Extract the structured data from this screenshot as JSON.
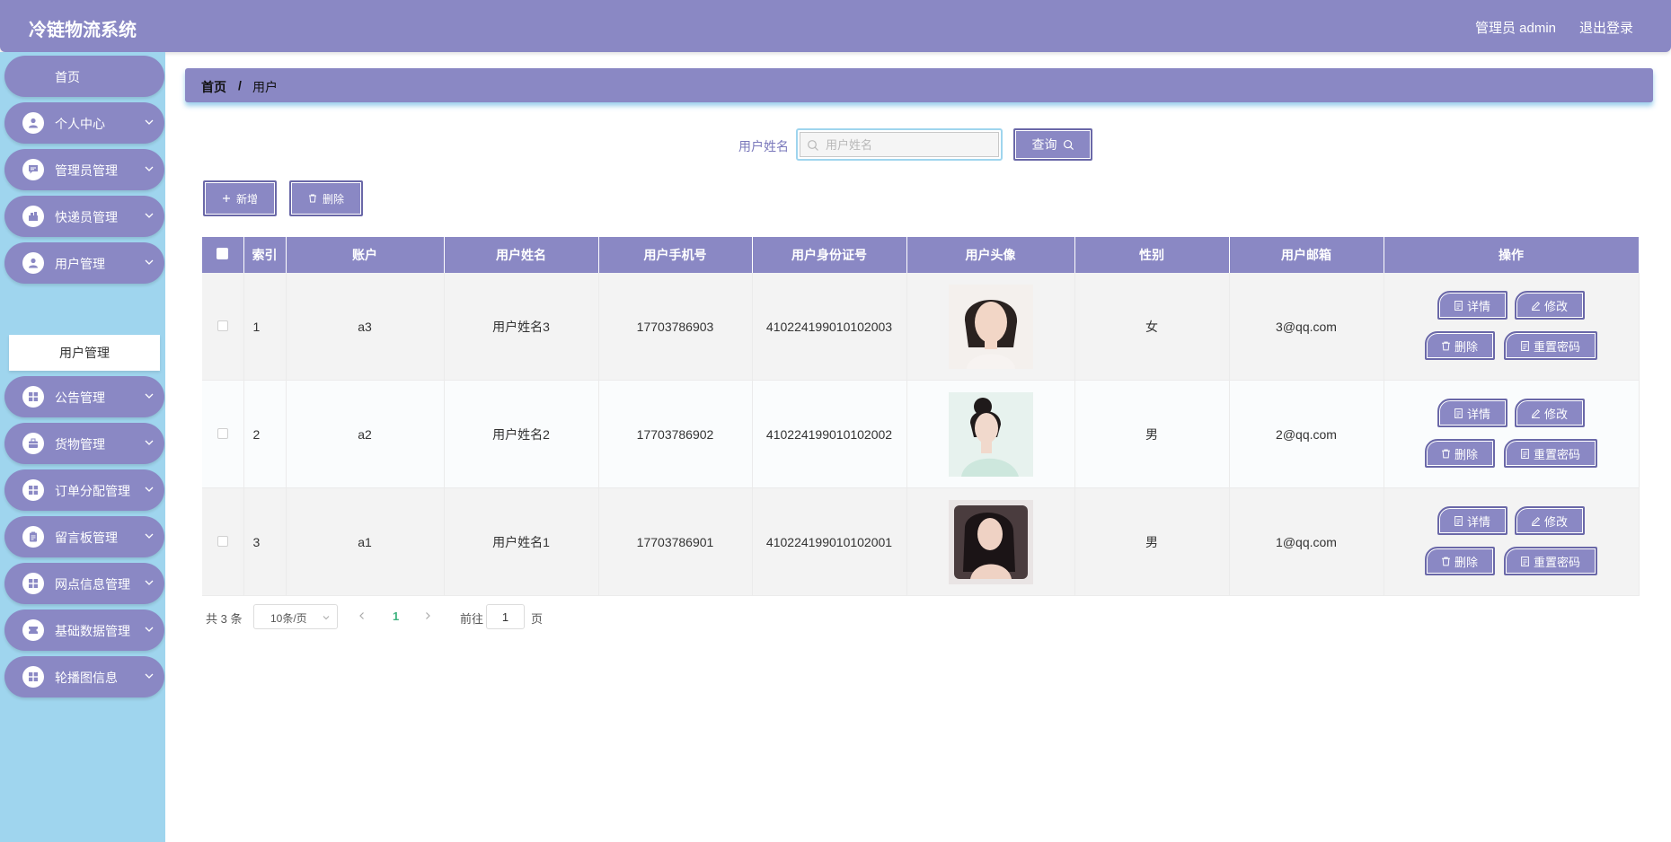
{
  "header": {
    "app_title": "冷链物流系统",
    "admin_label": "管理员 admin",
    "logout_label": "退出登录"
  },
  "sidebar": {
    "home_label": "首页",
    "items": [
      {
        "label": "个人中心",
        "icon": "user-icon"
      },
      {
        "label": "管理员管理",
        "icon": "chat-icon"
      },
      {
        "label": "快递员管理",
        "icon": "courier-icon"
      },
      {
        "label": "用户管理",
        "icon": "user-icon",
        "expanded": true,
        "sub": "用户管理"
      },
      {
        "label": "公告管理",
        "icon": "grid-icon"
      },
      {
        "label": "货物管理",
        "icon": "briefcase-icon"
      },
      {
        "label": "订单分配管理",
        "icon": "grid-icon"
      },
      {
        "label": "留言板管理",
        "icon": "clipboard-icon"
      },
      {
        "label": "网点信息管理",
        "icon": "grid-icon"
      },
      {
        "label": "基础数据管理",
        "icon": "ticket-icon"
      },
      {
        "label": "轮播图信息",
        "icon": "grid-icon"
      }
    ]
  },
  "breadcrumb": {
    "home": "首页",
    "separator": "/",
    "current": "用户"
  },
  "search": {
    "label": "用户姓名",
    "placeholder": "用户姓名",
    "query_label": "查询"
  },
  "toolbar": {
    "add_label": "新增",
    "delete_label": "删除"
  },
  "table": {
    "columns": [
      "索引",
      "账户",
      "用户姓名",
      "用户手机号",
      "用户身份证号",
      "用户头像",
      "性别",
      "用户邮箱",
      "操作"
    ],
    "rows": [
      {
        "index": "1",
        "account": "a3",
        "name": "用户姓名3",
        "phone": "17703786903",
        "id_card": "410224199010102003",
        "gender": "女",
        "email": "3@qq.com"
      },
      {
        "index": "2",
        "account": "a2",
        "name": "用户姓名2",
        "phone": "17703786902",
        "id_card": "410224199010102002",
        "gender": "男",
        "email": "2@qq.com"
      },
      {
        "index": "3",
        "account": "a1",
        "name": "用户姓名1",
        "phone": "17703786901",
        "id_card": "410224199010102001",
        "gender": "男",
        "email": "1@qq.com"
      }
    ],
    "actions": {
      "detail": "详情",
      "edit": "修改",
      "delete": "删除",
      "reset": "重置密码"
    }
  },
  "pagination": {
    "total": "共 3 条",
    "page_size": "10条/页",
    "current_page": "1",
    "goto_prefix": "前往",
    "goto_value": "1",
    "goto_suffix": "页"
  },
  "colors": {
    "primary": "#8a88c4",
    "sidebar_bg": "#9fd5ee",
    "active_page": "#3fb37f"
  }
}
